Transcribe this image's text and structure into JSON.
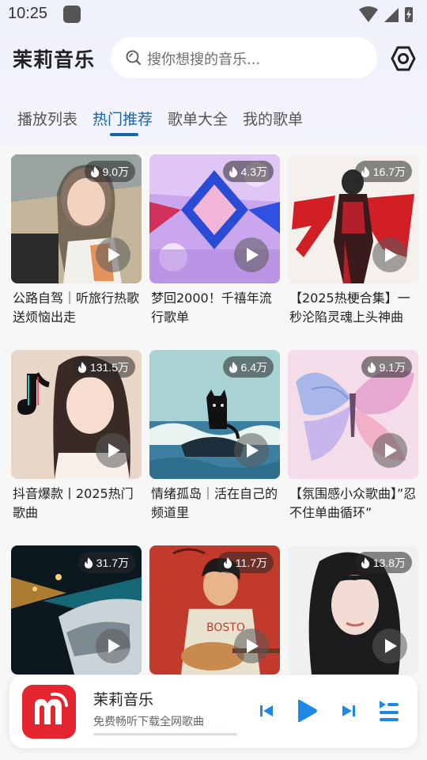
{
  "status_bar": {
    "time": "10:25"
  },
  "header": {
    "app_title": "茉莉音乐",
    "search_placeholder": "搜你想搜的音乐..."
  },
  "tabs": [
    {
      "label": "播放列表",
      "active": false
    },
    {
      "label": "热门推荐",
      "active": true
    },
    {
      "label": "歌单大全",
      "active": false
    },
    {
      "label": "我的歌单",
      "active": false
    }
  ],
  "playlists": [
    {
      "plays": "9.0万",
      "title": "公路自驾｜听旅行热歌送烦恼出走"
    },
    {
      "plays": "4.3万",
      "title": "梦回2000！千禧年流行歌单"
    },
    {
      "plays": "16.7万",
      "title": "【2025热梗合集】一秒沦陷灵魂上头神曲"
    },
    {
      "plays": "131.5万",
      "title": "抖音爆款丨2025热门歌曲"
    },
    {
      "plays": "6.4万",
      "title": "情绪孤岛｜活在自己的频道里"
    },
    {
      "plays": "9.1万",
      "title": "【氛围感小众歌曲】”忍不住单曲循环”"
    },
    {
      "plays": "31.7万",
      "title": ""
    },
    {
      "plays": "11.7万",
      "title": ""
    },
    {
      "plays": "13.8万",
      "title": ""
    }
  ],
  "player": {
    "title": "茉莉音乐",
    "subtitle": "免费畅听下载全网歌曲"
  },
  "colors": {
    "accent": "#1a64a8",
    "player_controls": "#1e88e5",
    "logo_red": "#e52530"
  }
}
